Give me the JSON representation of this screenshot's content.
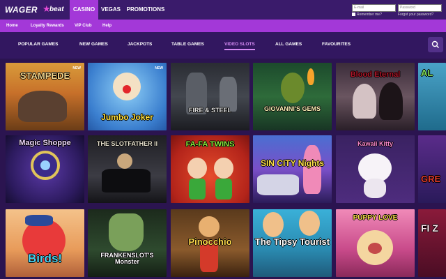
{
  "brand": {
    "logo_main": "WAGER",
    "logo_accent": "beat"
  },
  "main_nav": [
    {
      "label": "CASINO",
      "active": true
    },
    {
      "label": "VEGAS",
      "active": false
    },
    {
      "label": "PROMOTIONS",
      "active": false
    }
  ],
  "login": {
    "email_placeholder": "E-mail",
    "password_placeholder": "Password",
    "remember_label": "Remember me?",
    "forgot_label": "Forgot your password?"
  },
  "sub_nav": [
    "Home",
    "Loyalty Rewards",
    "VIP Club",
    "Help"
  ],
  "categories": [
    {
      "label": "POPULAR GAMES",
      "active": false
    },
    {
      "label": "NEW GAMES",
      "active": false
    },
    {
      "label": "JACKPOTS",
      "active": false
    },
    {
      "label": "TABLE GAMES",
      "active": false
    },
    {
      "label": "VIDEO SLOTS",
      "active": true
    },
    {
      "label": "ALL GAMES",
      "active": false
    },
    {
      "label": "FAVOURITES",
      "active": false
    }
  ],
  "games": [
    {
      "title": "STAMPEDE",
      "badge": "NEW"
    },
    {
      "title": "Jumbo Joker",
      "badge": "NEW"
    },
    {
      "title": "FIRE & STEEL",
      "badge": ""
    },
    {
      "title": "GIOVANNI'S GEMS",
      "badge": ""
    },
    {
      "title": "Blood Eternal",
      "badge": ""
    },
    {
      "title": "AL",
      "badge": ""
    },
    {
      "title": "Magic Shoppe",
      "badge": ""
    },
    {
      "title": "THE SLOTFATHER II",
      "badge": ""
    },
    {
      "title": "FA-FA TWINS",
      "badge": ""
    },
    {
      "title": "SIN CITY Nights",
      "badge": ""
    },
    {
      "title": "Kawaii Kitty",
      "badge": ""
    },
    {
      "title": "GRE",
      "badge": ""
    },
    {
      "title": "Birds!",
      "badge": ""
    },
    {
      "title": "FRANKENSLOT'S Monster",
      "badge": ""
    },
    {
      "title": "Pinocchio",
      "badge": ""
    },
    {
      "title": "The Tipsy Tourist",
      "badge": ""
    },
    {
      "title": "PUPPY LOVE",
      "badge": ""
    },
    {
      "title": "FI Z",
      "badge": ""
    }
  ],
  "colors": {
    "background": "#2b1450",
    "accent": "#a338d8",
    "active_category": "#d58af3"
  }
}
